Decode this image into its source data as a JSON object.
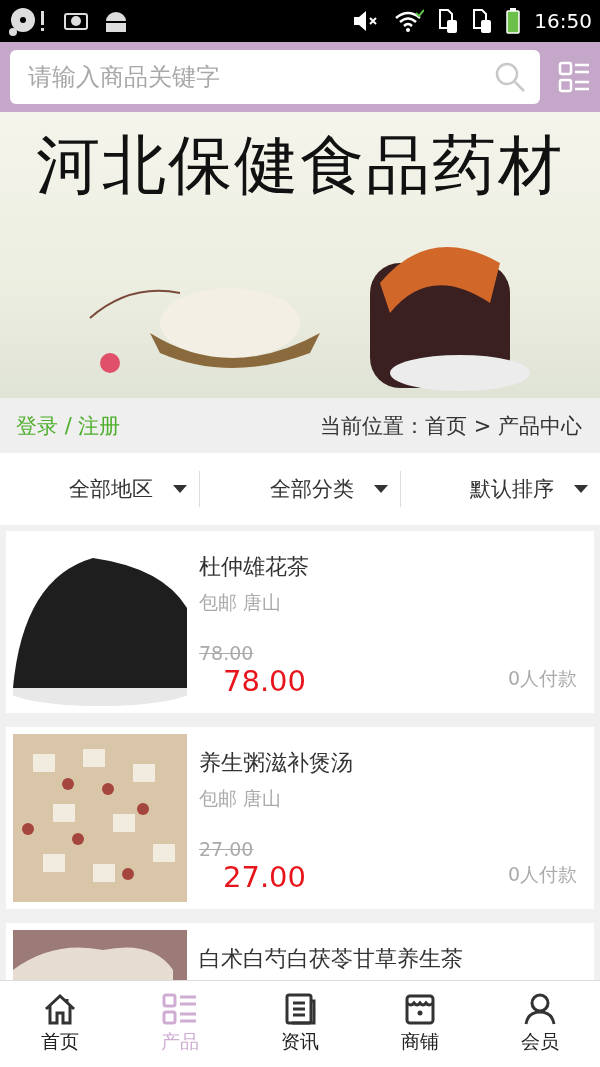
{
  "status_bar": {
    "time": "16:50"
  },
  "search": {
    "placeholder": "请输入商品关键字"
  },
  "banner": {
    "title": "河北保健食品药材"
  },
  "breadcrumb": {
    "login": "登录 / 注册",
    "location": "当前位置：首页 > 产品中心"
  },
  "filters": [
    {
      "label": "全部地区"
    },
    {
      "label": "全部分类"
    },
    {
      "label": "默认排序"
    }
  ],
  "products": [
    {
      "name": "杜仲雄花茶",
      "shipping": "包邮 唐山",
      "original_price": "78.00",
      "price": "78.00",
      "sales": "0人付款",
      "kind": "tea"
    },
    {
      "name": "养生粥滋补煲汤",
      "shipping": "包邮 唐山",
      "original_price": "27.00",
      "price": "27.00",
      "sales": "0人付款",
      "kind": "grains"
    },
    {
      "name": "白术白芍白茯苓甘草养生茶",
      "kind": "powder"
    }
  ],
  "nav": [
    {
      "label": "首页",
      "kind": "home",
      "selected": false
    },
    {
      "label": "产品",
      "kind": "grid",
      "selected": true
    },
    {
      "label": "资讯",
      "kind": "news",
      "selected": false
    },
    {
      "label": "商铺",
      "kind": "shop",
      "selected": false
    },
    {
      "label": "会员",
      "kind": "user",
      "selected": false
    }
  ]
}
